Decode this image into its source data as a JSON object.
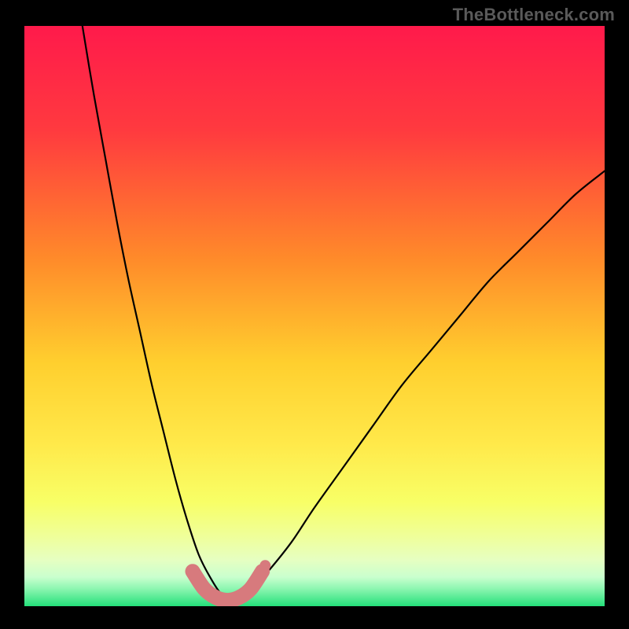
{
  "watermark": "TheBottleneck.com",
  "chart_data": {
    "type": "line",
    "title": "",
    "xlabel": "",
    "ylabel": "",
    "xlim": [
      0,
      100
    ],
    "ylim": [
      0,
      100
    ],
    "grid": false,
    "legend": false,
    "annotations": [],
    "background_gradient": {
      "top": "#ff1a4b",
      "mid_upper": "#ff8a2a",
      "mid": "#ffe233",
      "mid_lower": "#f4ff66",
      "band": "#eaffb3",
      "bottom": "#24e07a"
    },
    "curve_note": "Smooth V-shaped bottleneck curve; minimum near x≈35 reaching y≈1. Left branch steeper than right.",
    "series": [
      {
        "name": "bottleneck-curve",
        "color": "#000000",
        "stroke_width": 2,
        "x": [
          10,
          12,
          14,
          16,
          18,
          20,
          22,
          24,
          26,
          28,
          30,
          32,
          34,
          36,
          38,
          40,
          42,
          46,
          50,
          55,
          60,
          65,
          70,
          75,
          80,
          85,
          90,
          95,
          100
        ],
        "y": [
          100,
          88,
          77,
          66,
          56,
          47,
          38,
          30,
          22,
          15,
          9,
          5,
          2,
          1,
          2,
          4,
          6,
          11,
          17,
          24,
          31,
          38,
          44,
          50,
          56,
          61,
          66,
          71,
          75
        ]
      },
      {
        "name": "highlight-band",
        "color": "#d77a7d",
        "stroke_width": 12,
        "style": "round-cap",
        "x": [
          29,
          31,
          33,
          35,
          37,
          39,
          41
        ],
        "y": [
          6,
          3,
          1.5,
          1,
          1.5,
          3,
          6
        ]
      }
    ],
    "highlight_dot": {
      "x": 41.5,
      "y": 7,
      "r": 5,
      "color": "#d77a7d"
    }
  }
}
